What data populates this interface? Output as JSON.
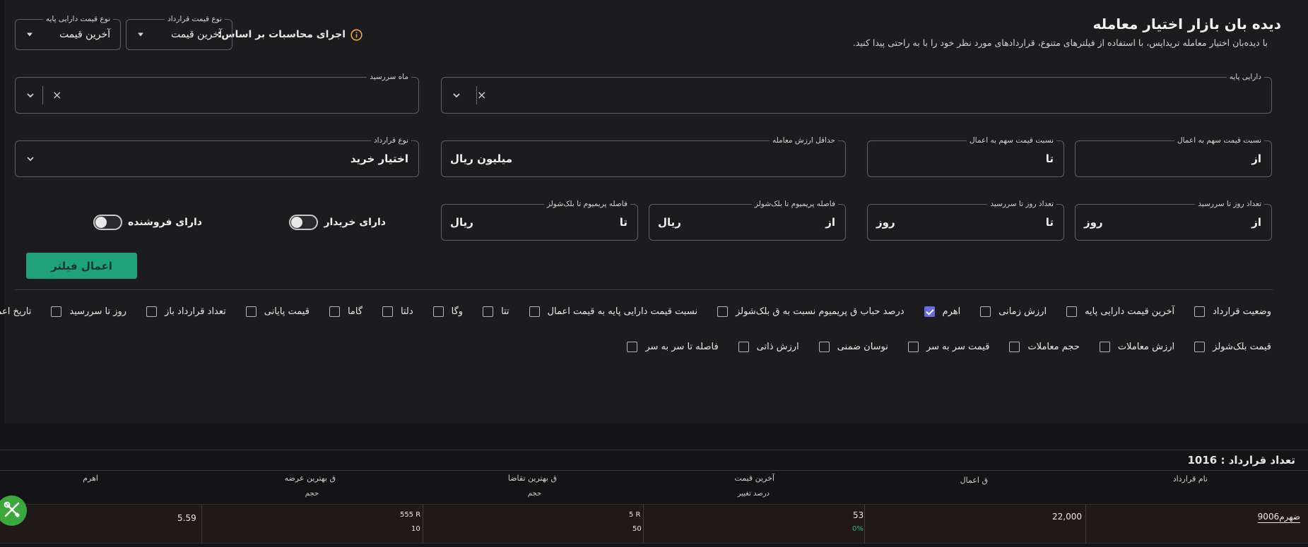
{
  "header": {
    "title": "دیده بان بازار اختیار معامله",
    "subtitle": "با دیده‌بان اختیار معامله تریداپس، با استفاده از فیلترهای متنوع، قراردادهای مورد نظر خود را با به راحتی پیدا کنید."
  },
  "calc": {
    "label": "اجرای محاسبات بر اساس:",
    "contract_price_type": {
      "legend": "نوع قیمت قرارداد",
      "value": "آخرین قیمت"
    },
    "base_price_type": {
      "legend": "نوع قیمت دارایی پایه",
      "value": "آخرین قیمت"
    }
  },
  "filters": {
    "base_asset": {
      "legend": "دارایی پایه",
      "clear": "×"
    },
    "expiry_month": {
      "legend": "ماه سررسید",
      "clear": "×"
    },
    "ratio_from": {
      "legend": "نسبت قیمت سهم به اعمال",
      "value": "از"
    },
    "ratio_to": {
      "legend": "نسبت قیمت سهم به اعمال",
      "value": "تا"
    },
    "min_value": {
      "legend": "حداقل ارزش معامله",
      "value": "میلیون ریال"
    },
    "contract_type": {
      "legend": "نوع قرارداد",
      "value": "اختیار خرید"
    },
    "days_from": {
      "legend": "تعداد روز تا سررسید",
      "value": "از",
      "suffix": "روز"
    },
    "days_to": {
      "legend": "تعداد روز تا سررسید",
      "value": "تا",
      "suffix": "روز"
    },
    "premium_from": {
      "legend": "فاصله پریمیوم تا بلک‌شولز",
      "value": "از",
      "suffix": "ریال"
    },
    "premium_to": {
      "legend": "فاصله پریمیوم تا بلک‌شولز",
      "value": "تا",
      "suffix": "ریال"
    },
    "has_buyer": "دارای خریدار",
    "has_seller": "دارای فروشنده",
    "apply": "اعمال فیلتر"
  },
  "columns_row1": [
    {
      "label": "وضعیت قرارداد",
      "checked": false
    },
    {
      "label": "آخرین قیمت دارایی پایه",
      "checked": false
    },
    {
      "label": "ارزش زمانی",
      "checked": false
    },
    {
      "label": "اهرم",
      "checked": true
    },
    {
      "label": "درصد حباب ق پریمیوم نسبت به ق بلک‌شولز",
      "checked": false
    },
    {
      "label": "نسبت قیمت دارایی پایه به قیمت اعمال",
      "checked": false
    },
    {
      "label": "تتا",
      "checked": false
    },
    {
      "label": "وگا",
      "checked": false
    },
    {
      "label": "دلتا",
      "checked": false
    },
    {
      "label": "گاما",
      "checked": false
    },
    {
      "label": "قیمت پایانی",
      "checked": false
    },
    {
      "label": "تعداد قرارداد باز",
      "checked": false
    },
    {
      "label": "روز تا سررسید",
      "checked": false
    },
    {
      "label": "تاریخ اعمال",
      "checked": false
    }
  ],
  "columns_row2": [
    {
      "label": "قیمت بلک‌شولز",
      "checked": false
    },
    {
      "label": "ارزش معاملات",
      "checked": false
    },
    {
      "label": "حجم معاملات",
      "checked": false
    },
    {
      "label": "قیمت سر به سر",
      "checked": false
    },
    {
      "label": "نوسان ضمنی",
      "checked": false
    },
    {
      "label": "ارزش ذاتی",
      "checked": false
    },
    {
      "label": "فاصله تا سر به سر",
      "checked": false
    }
  ],
  "table": {
    "count_label": "تعداد قرارداد : 1016",
    "headers": {
      "name": "نام قرارداد",
      "strike": "ق اعمال",
      "last_price": "آخرین قیمت",
      "change_pct": "درصد تغییر",
      "best_bid": "ق بهترین تقاضا",
      "bid_volume": "حجم",
      "best_ask": "ق بهترین عرضه",
      "ask_volume": "حجم",
      "leverage": "اهرم"
    },
    "rows": [
      {
        "name": "ضهرم9006",
        "strike": "22,000",
        "last_price": "53",
        "change_pct": "0%",
        "best_bid": "5 R",
        "bid_volume": "50",
        "best_ask": "555 R",
        "ask_volume": "10",
        "leverage": "5.59"
      }
    ]
  },
  "colors": {
    "accent_green": "#1fa27a",
    "checkbox_checked": "#6b6be0",
    "positive": "#27c07d"
  }
}
